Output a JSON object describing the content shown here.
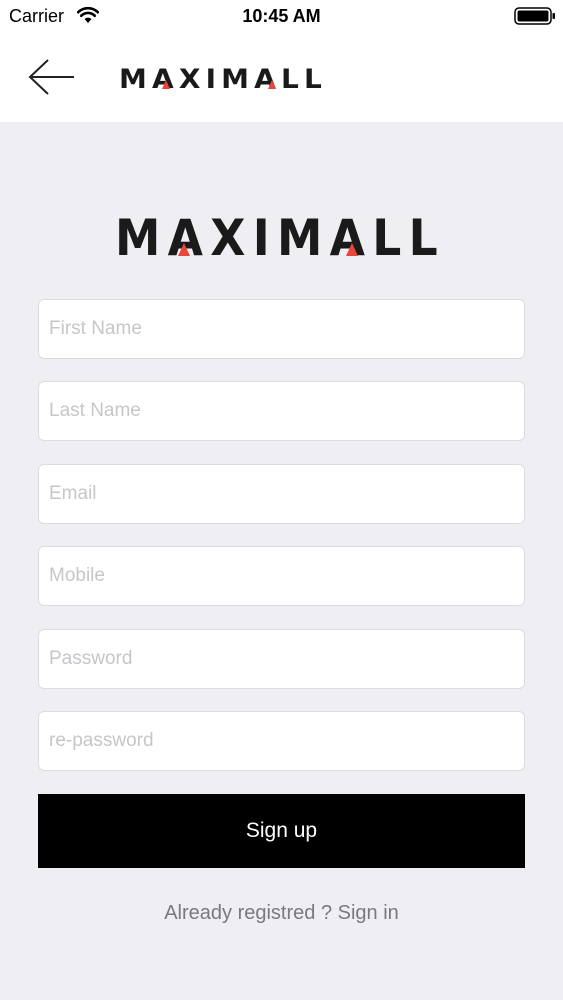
{
  "status_bar": {
    "carrier": "Carrier",
    "time": "10:45 AM",
    "wifi_icon": "wifi-icon",
    "battery_icon": "battery-full-icon"
  },
  "header": {
    "back_icon": "arrow-left-icon",
    "logo_text": "MAXIMALL"
  },
  "brand": {
    "logo_text": "MAXIMALL",
    "accent_color": "#e8463c",
    "logo_color": "#1a1a1a"
  },
  "form": {
    "first_name_placeholder": "First Name",
    "last_name_placeholder": "Last Name",
    "email_placeholder": "Email",
    "mobile_placeholder": "Mobile",
    "password_placeholder": "Password",
    "repassword_placeholder": "re-password",
    "signup_label": "Sign up",
    "signin_link": "Already registred ? Sign in"
  }
}
